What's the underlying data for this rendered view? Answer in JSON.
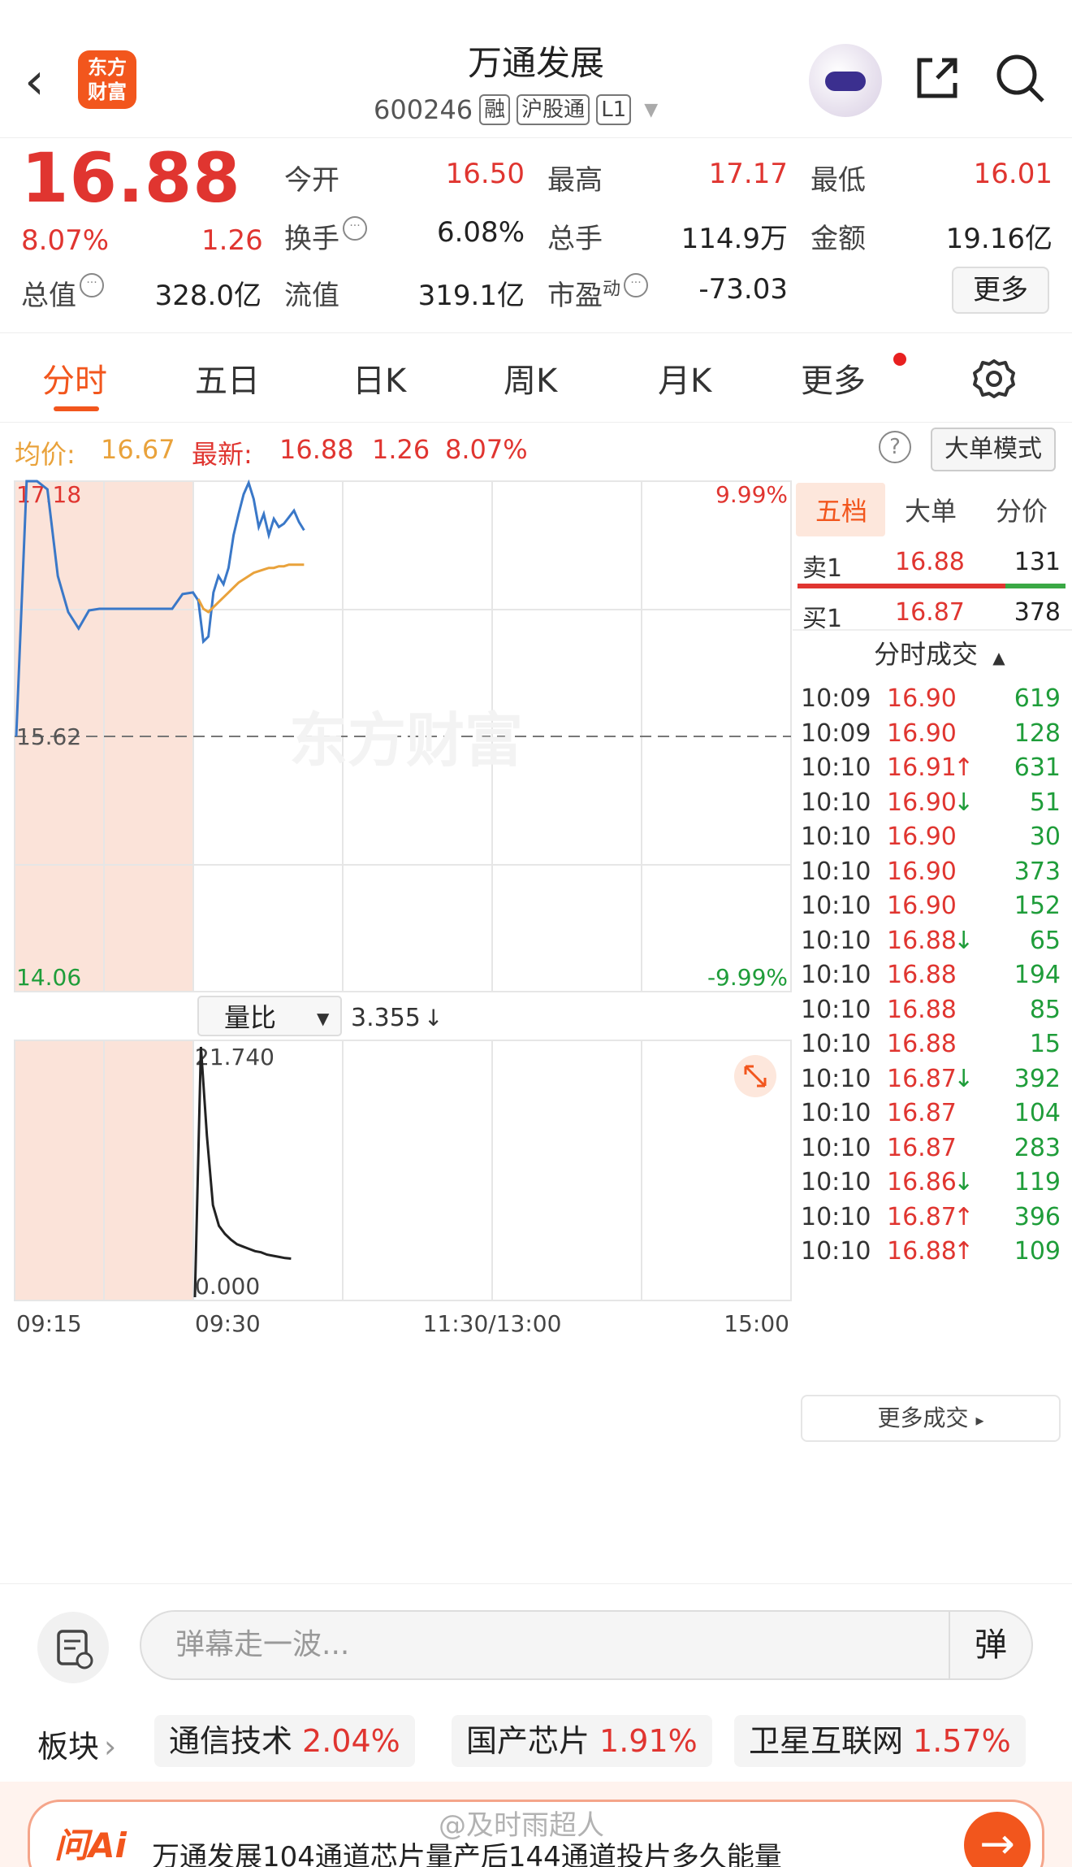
{
  "header": {
    "back_glyph": "‹",
    "logo_text_1": "东方",
    "logo_text_2": "财富",
    "title": "万通发展",
    "code": "600246",
    "tags": [
      "融",
      "沪股通",
      "L1"
    ]
  },
  "quote": {
    "price": "16.88",
    "change_pct": "8.07%",
    "change": "1.26",
    "metrics": [
      {
        "label": "今开",
        "value": "16.50",
        "color": "red"
      },
      {
        "label": "最高",
        "value": "17.17",
        "color": "red"
      },
      {
        "label": "最低",
        "value": "16.01",
        "color": "red"
      },
      {
        "label": "换手",
        "value": "6.08%",
        "color": "black"
      },
      {
        "label": "总手",
        "value": "114.9万",
        "color": "black"
      },
      {
        "label": "金额",
        "value": "19.16亿",
        "color": "black"
      },
      {
        "label": "总值",
        "value": "328.0亿",
        "color": "black"
      },
      {
        "label": "流值",
        "value": "319.1亿",
        "color": "black"
      },
      {
        "label": "市盈",
        "value": "-73.03",
        "color": "black"
      }
    ],
    "pe_sup": "动",
    "more_button": "更多"
  },
  "tabs": [
    "分时",
    "五日",
    "日K",
    "周K",
    "月K",
    "更多"
  ],
  "summary": {
    "avg_label": "均价:",
    "avg_value": "16.67",
    "latest_label": "最新:",
    "latest_value": "16.88",
    "latest_change": "1.26",
    "latest_pct": "8.07%",
    "help": "?",
    "mode_button": "大单模式"
  },
  "chart_data": {
    "type": "line",
    "title": "",
    "xlabel": "",
    "ylabel": "",
    "x_ticks": [
      "09:15",
      "09:30",
      "11:30/13:00",
      "15:00"
    ],
    "y_ticks_left": [
      "17.18",
      "15.62",
      "14.06"
    ],
    "y_ticks_right": [
      "9.99%",
      "-9.99%"
    ],
    "ylim": [
      14.06,
      17.18
    ],
    "prev_close": 15.62,
    "watermark": "东方财富",
    "series": [
      {
        "color": "#3a78c8",
        "x": [
          0,
          1,
          2,
          3,
          4,
          5,
          6,
          7,
          8,
          9,
          10,
          11,
          12,
          13,
          14,
          15,
          16,
          17,
          18,
          19,
          20,
          21,
          22,
          23,
          24,
          25,
          26,
          27,
          28,
          29,
          30,
          31,
          32,
          33,
          34,
          35,
          36,
          37,
          38,
          39
        ],
        "y": [
          15.62,
          17.18,
          17.18,
          17.13,
          16.6,
          16.38,
          16.28,
          16.39,
          16.4,
          16.4,
          16.4,
          16.4,
          16.4,
          16.4,
          16.4,
          16.4,
          16.49,
          16.5,
          16.45,
          16.2,
          16.23,
          16.5,
          16.6,
          16.55,
          16.65,
          16.85,
          16.98,
          17.1,
          17.17,
          17.07,
          16.9,
          16.98,
          16.85,
          16.95,
          16.9,
          16.92,
          16.96,
          17.0,
          16.93,
          16.88
        ]
      },
      {
        "color": "#e9a23b",
        "x": [
          18,
          19,
          20,
          21,
          22,
          23,
          24,
          25,
          26,
          27,
          28,
          29,
          30,
          31,
          32,
          33,
          34,
          35,
          36,
          37,
          38,
          39
        ],
        "y": [
          16.46,
          16.4,
          16.38,
          16.41,
          16.44,
          16.47,
          16.5,
          16.53,
          16.56,
          16.58,
          16.6,
          16.62,
          16.63,
          16.64,
          16.65,
          16.65,
          16.66,
          16.66,
          16.67,
          16.67,
          16.67,
          16.67
        ]
      }
    ],
    "volume_ratio": {
      "label": "量比",
      "current": "3.355",
      "ylim": [
        0,
        21.74
      ],
      "y_ticks": [
        "21.740",
        "0.000"
      ],
      "x": [
        0,
        1,
        2,
        3,
        4,
        5,
        6,
        7,
        8,
        9,
        10,
        11,
        12,
        13,
        14,
        15,
        16
      ],
      "y": [
        0,
        21.74,
        14.0,
        8.0,
        6.2,
        5.5,
        5.0,
        4.6,
        4.4,
        4.2,
        4.0,
        3.9,
        3.7,
        3.6,
        3.5,
        3.4,
        3.355
      ]
    }
  },
  "right_panel": {
    "tabs": [
      "五档",
      "大单",
      "分价"
    ],
    "sell": {
      "label": "卖1",
      "price": "16.88",
      "vol": "131"
    },
    "buy": {
      "label": "买1",
      "price": "16.87",
      "vol": "378"
    },
    "trades_title": "分时成交",
    "trades": [
      {
        "t": "10:09",
        "p": "16.90",
        "arrow": "",
        "v": "619"
      },
      {
        "t": "10:09",
        "p": "16.90",
        "arrow": "",
        "v": "128"
      },
      {
        "t": "10:10",
        "p": "16.91",
        "arrow": "↑",
        "v": "631"
      },
      {
        "t": "10:10",
        "p": "16.90",
        "arrow": "↓",
        "v": "51"
      },
      {
        "t": "10:10",
        "p": "16.90",
        "arrow": "",
        "v": "30"
      },
      {
        "t": "10:10",
        "p": "16.90",
        "arrow": "",
        "v": "373"
      },
      {
        "t": "10:10",
        "p": "16.90",
        "arrow": "",
        "v": "152"
      },
      {
        "t": "10:10",
        "p": "16.88",
        "arrow": "↓",
        "v": "65"
      },
      {
        "t": "10:10",
        "p": "16.88",
        "arrow": "",
        "v": "194"
      },
      {
        "t": "10:10",
        "p": "16.88",
        "arrow": "",
        "v": "85"
      },
      {
        "t": "10:10",
        "p": "16.88",
        "arrow": "",
        "v": "15"
      },
      {
        "t": "10:10",
        "p": "16.87",
        "arrow": "↓",
        "v": "392"
      },
      {
        "t": "10:10",
        "p": "16.87",
        "arrow": "",
        "v": "104"
      },
      {
        "t": "10:10",
        "p": "16.87",
        "arrow": "",
        "v": "283"
      },
      {
        "t": "10:10",
        "p": "16.86",
        "arrow": "↓",
        "v": "119"
      },
      {
        "t": "10:10",
        "p": "16.87",
        "arrow": "↑",
        "v": "396"
      },
      {
        "t": "10:10",
        "p": "16.88",
        "arrow": "↑",
        "v": "109"
      }
    ],
    "more_trades": "更多成交"
  },
  "comment": {
    "placeholder": "弹幕走一波...",
    "send": "弹"
  },
  "sectors": {
    "label": "板块",
    "items": [
      {
        "name": "通信技术",
        "pct": "2.04%"
      },
      {
        "name": "国产芯片",
        "pct": "1.91%"
      },
      {
        "name": "卫星互联网",
        "pct": "1.57%"
      }
    ]
  },
  "ai": {
    "logo": "问Ai",
    "text": "万通发展104通道芯片量产后144通道投片多久能量",
    "go": "→",
    "watermark": "@及时雨超人"
  }
}
